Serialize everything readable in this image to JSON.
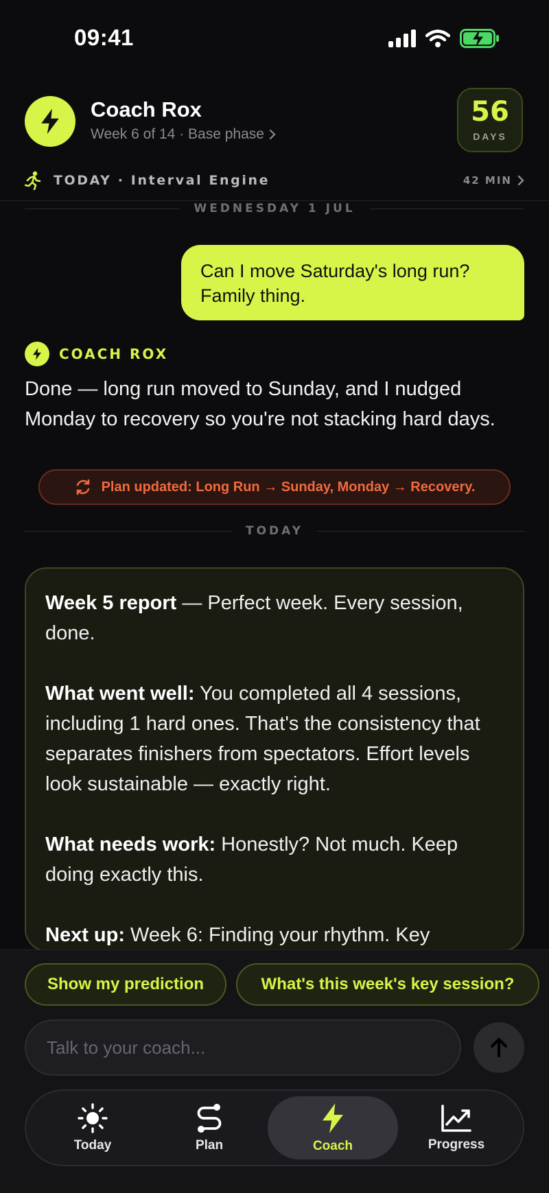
{
  "status_bar": {
    "time": "09:41"
  },
  "header": {
    "coach_name": "Coach Rox",
    "subtitle": "Week 6 of 14 · Base phase",
    "days_count": "56",
    "days_label": "DAYS"
  },
  "today_row": {
    "label": "TODAY · Interval Engine",
    "duration": "42 MIN"
  },
  "chat": {
    "divider_1": "WEDNESDAY 1 JUL",
    "user_message": "Can I move Saturday's long run? Family thing.",
    "coach_tag": "COACH ROX",
    "coach_message": "Done — long run moved to Sunday, and I nudged Monday to recovery so you're not stacking hard days.",
    "plan_update": "Plan updated: Long Run → Sunday, Monday → Recovery.",
    "divider_2": "TODAY"
  },
  "report": {
    "p1_bold": "Week 5 report",
    "p1_text": " — Perfect week. Every session, done.",
    "p2_bold": "What went well:",
    "p2_text": " You completed all 4 sessions, including 1 hard ones. That's the consistency that separates finishers from spectators. Effort levels look sustainable — exactly right.",
    "p3_bold": "What needs work:",
    "p3_text": " Honestly? Not much. Keep doing exactly this.",
    "p4_bold": "Next up:",
    "p4_text": " Week 6: Finding your rhythm. Key"
  },
  "suggestions": [
    "Show my prediction",
    "What's this week's key session?"
  ],
  "composer": {
    "placeholder": "Talk to your coach..."
  },
  "tabs": [
    {
      "label": "Today",
      "icon": "sun-icon"
    },
    {
      "label": "Plan",
      "icon": "route-icon"
    },
    {
      "label": "Coach",
      "icon": "bolt-icon",
      "active": true
    },
    {
      "label": "Progress",
      "icon": "trend-chart-icon"
    }
  ],
  "colors": {
    "accent": "#d7f548",
    "alert": "#f26a3e",
    "background": "#0c0c0f"
  }
}
